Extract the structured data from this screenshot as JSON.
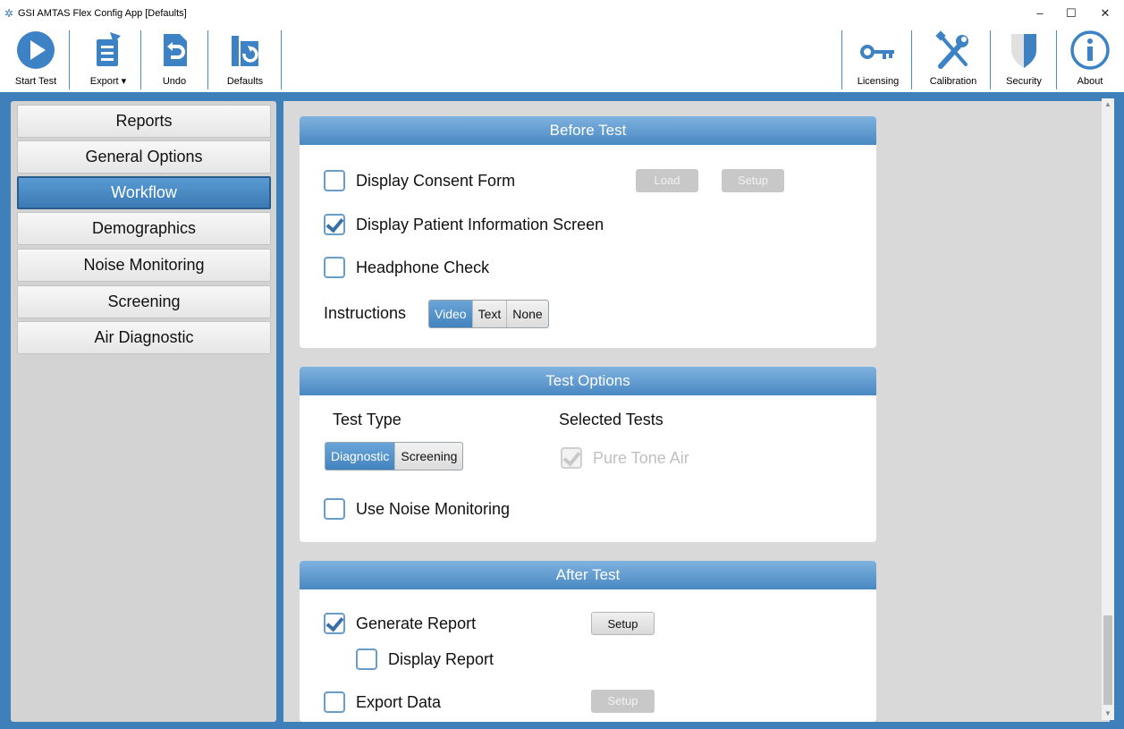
{
  "window": {
    "title": "GSI AMTAS Flex Config App [Defaults]"
  },
  "toolbar": {
    "left": [
      {
        "label": "Start Test",
        "icon": "play-icon"
      },
      {
        "label": "Export",
        "icon": "export-icon"
      },
      {
        "label": "Undo",
        "icon": "undo-icon"
      },
      {
        "label": "Defaults",
        "icon": "defaults-icon"
      }
    ],
    "right": [
      {
        "label": "Licensing",
        "icon": "key-icon"
      },
      {
        "label": "Calibration",
        "icon": "tools-icon"
      },
      {
        "label": "Security",
        "icon": "shield-icon"
      },
      {
        "label": "About",
        "icon": "info-icon"
      }
    ]
  },
  "sidebar": {
    "items": [
      {
        "label": "Reports"
      },
      {
        "label": "General Options"
      },
      {
        "label": "Workflow",
        "active": true
      },
      {
        "label": "Demographics"
      },
      {
        "label": "Noise Monitoring"
      },
      {
        "label": "Screening"
      },
      {
        "label": "Air Diagnostic"
      }
    ]
  },
  "before_test": {
    "title": "Before Test",
    "consent": {
      "label": "Display Consent Form",
      "checked": false,
      "load": "Load",
      "setup": "Setup"
    },
    "patient_info": {
      "label": "Display Patient Information Screen",
      "checked": true
    },
    "headphone": {
      "label": "Headphone Check",
      "checked": false
    },
    "instructions": {
      "label": "Instructions",
      "options": [
        "Video",
        "Text",
        "None"
      ],
      "selected": "Video"
    }
  },
  "test_options": {
    "title": "Test Options",
    "test_type": {
      "label": "Test Type",
      "options": [
        "Diagnostic",
        "Screening"
      ],
      "selected": "Diagnostic"
    },
    "selected_tests": {
      "label": "Selected Tests",
      "pure_tone": "Pure Tone Air",
      "checked": true
    },
    "noise_monitoring": {
      "label": "Use Noise Monitoring",
      "checked": false
    }
  },
  "after_test": {
    "title": "After Test",
    "generate_report": {
      "label": "Generate Report",
      "checked": true,
      "setup": "Setup"
    },
    "display_report": {
      "label": "Display Report",
      "checked": false
    },
    "export_data": {
      "label": "Export Data",
      "checked": false,
      "setup": "Setup"
    }
  },
  "colors": {
    "accent": "#3f7fba",
    "header": "#4a88c2"
  }
}
